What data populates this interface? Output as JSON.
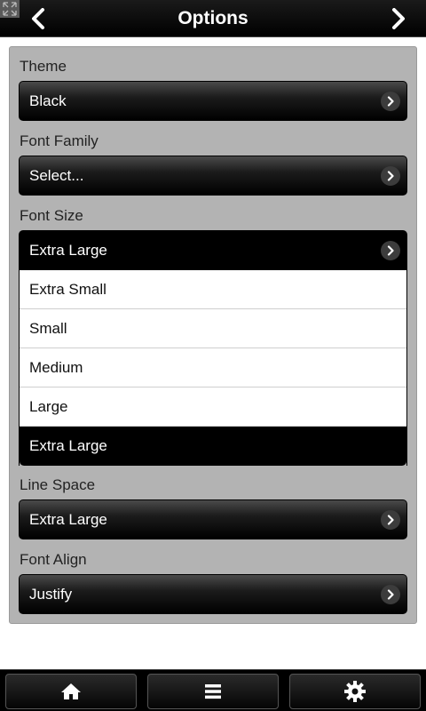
{
  "header": {
    "title": "Options",
    "back_icon": "chevron-left-icon",
    "forward_icon": "chevron-right-icon"
  },
  "fields": {
    "theme": {
      "label": "Theme",
      "value": "Black"
    },
    "font_family": {
      "label": "Font Family",
      "value": "Select..."
    },
    "font_size": {
      "label": "Font Size",
      "value": "Extra Large",
      "options": [
        "Extra Small",
        "Small",
        "Medium",
        "Large",
        "Extra Large"
      ]
    },
    "line_space": {
      "label": "Line Space",
      "value": "Extra Large"
    },
    "font_align": {
      "label": "Font Align",
      "value": "Justify"
    }
  },
  "bottom_bar": {
    "tabs": [
      "home-icon",
      "menu-icon",
      "gear-icon"
    ]
  },
  "colors": {
    "header_bg": "#000000",
    "panel_bg": "#b3b3b3",
    "selected_bg": "#000000"
  }
}
